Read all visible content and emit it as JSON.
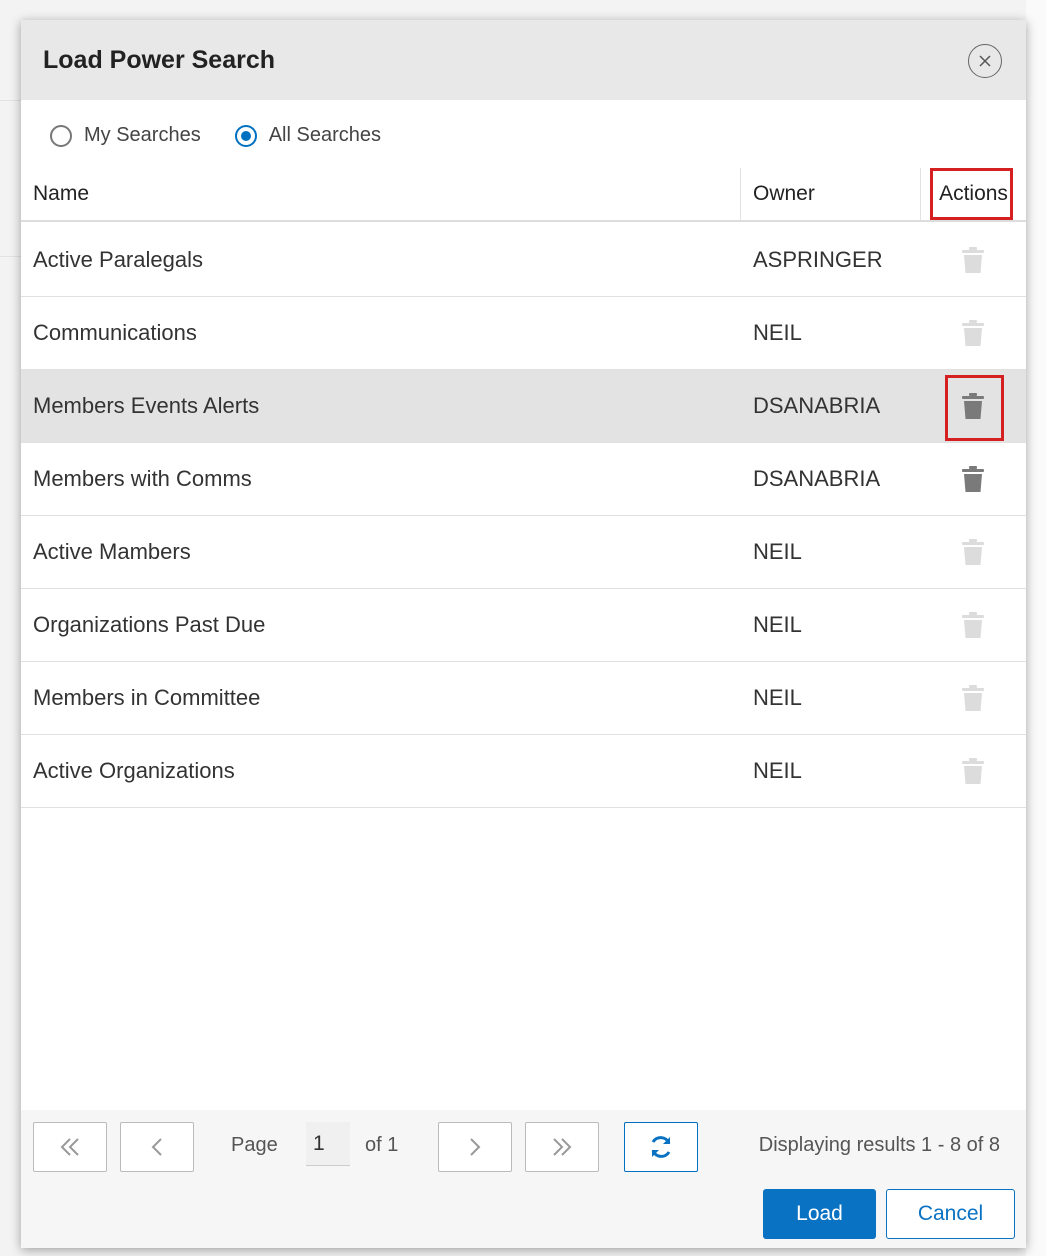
{
  "modal": {
    "title": "Load Power Search",
    "close_icon": "close-icon"
  },
  "filter": {
    "options": [
      {
        "label": "My Searches",
        "checked": false
      },
      {
        "label": "All Searches",
        "checked": true
      }
    ]
  },
  "grid": {
    "columns": {
      "name": "Name",
      "owner": "Owner",
      "actions": "Actions"
    },
    "rows": [
      {
        "name": "Active Paralegals",
        "owner": "ASPRINGER",
        "delete_enabled": false,
        "selected": false
      },
      {
        "name": "Communications",
        "owner": "NEIL",
        "delete_enabled": false,
        "selected": false
      },
      {
        "name": "Members Events Alerts",
        "owner": "DSANABRIA",
        "delete_enabled": true,
        "selected": true
      },
      {
        "name": "Members with Comms",
        "owner": "DSANABRIA",
        "delete_enabled": true,
        "selected": false
      },
      {
        "name": "Active Mambers",
        "owner": "NEIL",
        "delete_enabled": false,
        "selected": false
      },
      {
        "name": "Organizations Past Due",
        "owner": "NEIL",
        "delete_enabled": false,
        "selected": false
      },
      {
        "name": "Members in Committee",
        "owner": "NEIL",
        "delete_enabled": false,
        "selected": false
      },
      {
        "name": "Active Organizations",
        "owner": "NEIL",
        "delete_enabled": false,
        "selected": false
      }
    ]
  },
  "pager": {
    "page_label": "Page",
    "page_value": "1",
    "of_label": "of 1",
    "display_text": "Displaying results 1 - 8 of 8"
  },
  "buttons": {
    "load": "Load",
    "cancel": "Cancel"
  },
  "colors": {
    "accent": "#0a72c3",
    "highlight": "#d42020",
    "icon_enabled": "#7a7a7a",
    "icon_disabled": "#dcdcdc"
  }
}
